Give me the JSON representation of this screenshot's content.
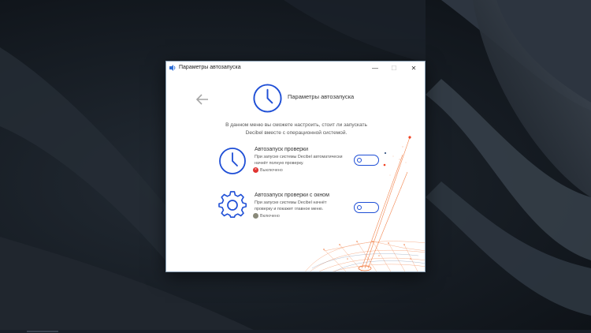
{
  "window": {
    "title": "Параметры автозапуска",
    "controls": {
      "minimize": "—",
      "maximize": "☐",
      "close": "✕"
    }
  },
  "header": {
    "title": "Параметры автозапуска",
    "description_line1": "В данном меню вы сможете настроить, стоит ли запускать",
    "description_line2": "Decibel вместе с операционной системой."
  },
  "options": [
    {
      "title": "Автозапуск проверки",
      "desc_line1": "При запуске системы Decibel автоматически",
      "desc_line2": "начнёт полную проверку.",
      "status": "Выключено",
      "status_symbol": "×",
      "status_color": "#e0322f",
      "icon": "clock-icon",
      "enabled": false
    },
    {
      "title": "Автозапуск проверки с окном",
      "desc_line1": "При запуске системы Decibel начнёт",
      "desc_line2": "проверку и покажет главное меню.",
      "status": "Включено",
      "status_symbol": "",
      "status_color": "#8a8a7a",
      "icon": "gear-icon",
      "enabled": true
    }
  ],
  "colors": {
    "accent": "#1f4fd6",
    "decor_accent": "#f07030",
    "off_status": "#e0322f",
    "on_status": "#8a8a7a"
  }
}
